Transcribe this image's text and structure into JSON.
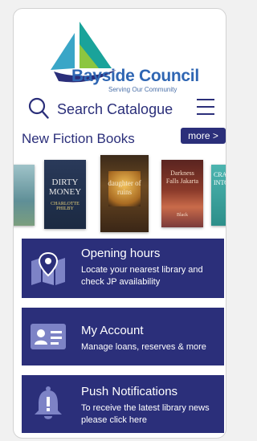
{
  "brand": {
    "name": "Bayside Council",
    "tagline": "Serving Our Community"
  },
  "search": {
    "label": "Search Catalogue"
  },
  "new_fiction": {
    "title": "New Fiction Books",
    "more_label": "more >",
    "books": [
      {
        "title": "",
        "author": ""
      },
      {
        "title": "DIRTY MONEY",
        "author": "CHARLOTTE PHILBY"
      },
      {
        "title": "daughter of ruins",
        "author": ""
      },
      {
        "title": "Darkness Falls Jakarta",
        "author": "Black"
      },
      {
        "title": "CRA INTO",
        "author": ""
      }
    ]
  },
  "cards": [
    {
      "title": "Opening hours",
      "subtitle": "Locate your nearest library and check JP availability",
      "icon": "map-pin-icon"
    },
    {
      "title": "My Account",
      "subtitle": "Manage loans, reserves & more",
      "icon": "id-card-icon"
    },
    {
      "title": "Push Notifications",
      "subtitle": "To receive the latest library news please click here",
      "icon": "bell-icon"
    }
  ],
  "colors": {
    "primary": "#2b2f7a",
    "brand_blue": "#2f66b3",
    "sail_teal": "#1aa39a",
    "sail_green": "#8cc63f"
  }
}
